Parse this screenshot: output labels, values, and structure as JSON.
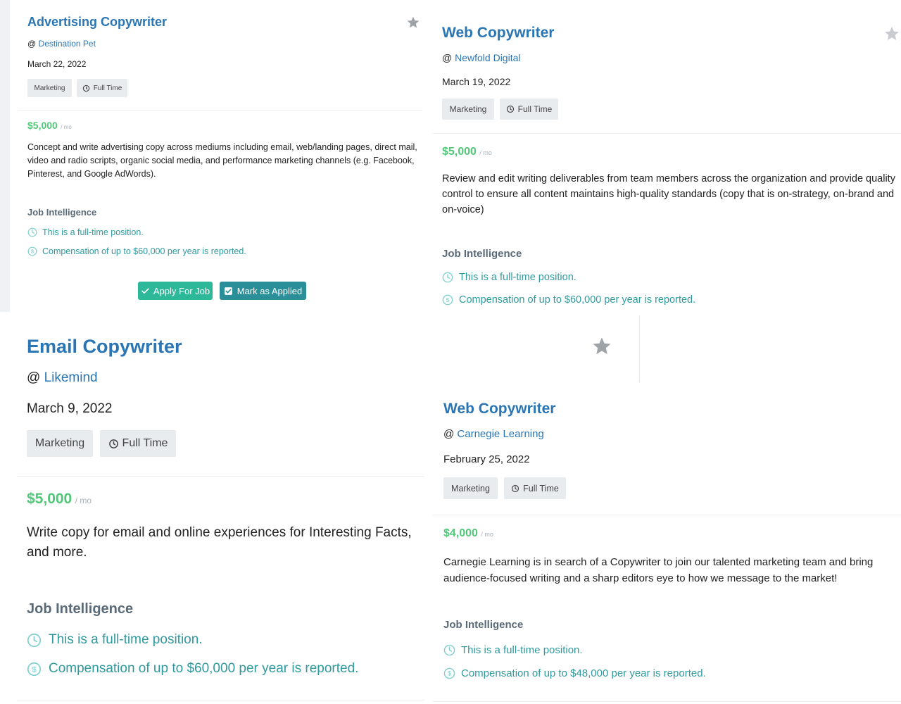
{
  "colors": {
    "title": "#2a76b5",
    "salary": "#52c77a",
    "intel": "#2f9a9d",
    "tag_bg": "#e8ecef",
    "apply_btn": "#2db89a",
    "mark_btn": "#2a8f98"
  },
  "cards": [
    {
      "title": "Advertising Copywriter",
      "at": "@",
      "company": "Destination Pet",
      "date": "March 22, 2022",
      "tags": [
        "Marketing",
        "Full Time"
      ],
      "salary": "$5,000",
      "salary_unit": "/ mo",
      "description": "Concept and write advertising copy across mediums including email, web/landing pages, direct mail, video and radio scripts, organic social media, and performance marketing channels (e.g. Facebook, Pinterest, and Google AdWords).",
      "intel_heading": "Job Intelligence",
      "intel": [
        "This is a full-time position.",
        "Compensation of up to $60,000 per year is reported."
      ],
      "buttons": [
        "Apply For Job",
        "Mark as Applied"
      ]
    },
    {
      "title": "Web Copywriter",
      "at": "@",
      "company": "Newfold Digital",
      "date": "March 19, 2022",
      "tags": [
        "Marketing",
        "Full Time"
      ],
      "salary": "$5,000",
      "salary_unit": "/ mo",
      "description": "Review and edit writing deliverables from team members across the organization and provide quality control to ensure all content maintains high-quality standards (copy that is on-strategy, on-brand and on-voice)",
      "intel_heading": "Job Intelligence",
      "intel": [
        "This is a full-time position.",
        "Compensation of up to $60,000 per year is reported."
      ]
    },
    {
      "title": "Email Copywriter",
      "at": "@",
      "company": "Likemind",
      "date": "March 9, 2022",
      "tags": [
        "Marketing",
        "Full Time"
      ],
      "salary": "$5,000",
      "salary_unit": "/ mo",
      "description": "Write copy for email and online experiences for Interesting Facts, and more.",
      "intel_heading": "Job Intelligence",
      "intel": [
        "This is a full-time position.",
        "Compensation of up to $60,000 per year is reported."
      ]
    },
    {
      "title": "Web Copywriter",
      "at": "@",
      "company": "Carnegie Learning",
      "date": "February 25, 2022",
      "tags": [
        "Marketing",
        "Full Time"
      ],
      "salary": "$4,000",
      "salary_unit": "/ mo",
      "description": "Carnegie Learning is in search of a Copywriter to join our talented marketing team and bring audience-focused writing and a sharp editors eye to how we message to the market!",
      "intel_heading": "Job Intelligence",
      "intel": [
        "This is a full-time position.",
        "Compensation of up to $48,000 per year is reported."
      ]
    }
  ]
}
